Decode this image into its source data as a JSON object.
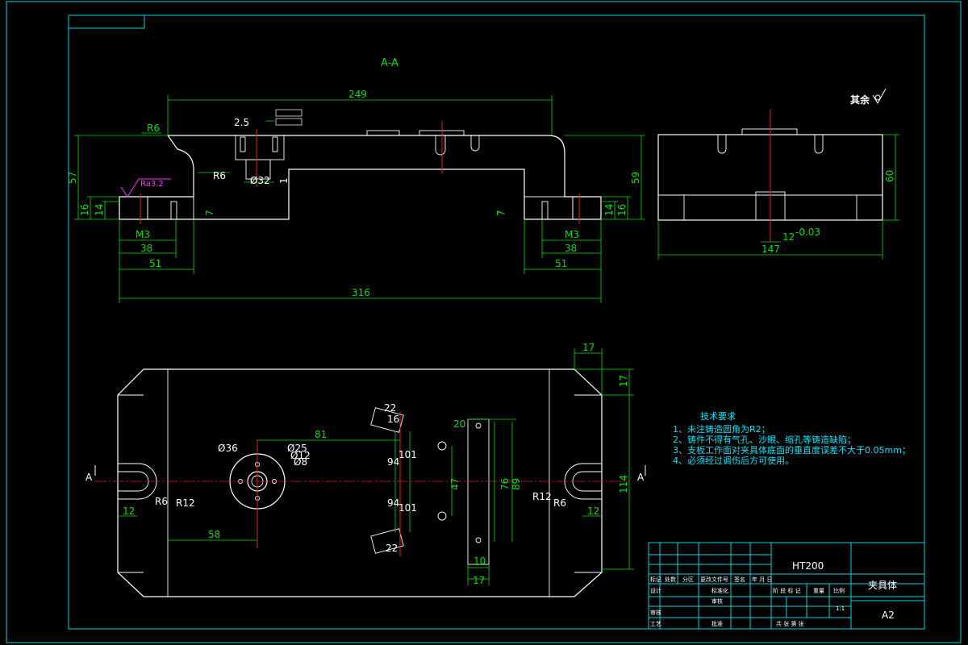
{
  "section_label": "A-A",
  "roughness_note": "其余",
  "ra_label": "Ra3.2",
  "section_marker": "A",
  "dims_top": {
    "d249": "249",
    "d316": "316",
    "d38L": "38",
    "d51L": "51",
    "d38R": "38",
    "d51R": "51",
    "d57": "57",
    "d59": "59",
    "d16L": "16",
    "d14L": "14",
    "d16R": "16",
    "d14R": "14",
    "d7L": "7",
    "d7R": "7",
    "m3L": "M3",
    "m3R": "M3",
    "r6a": "R6",
    "r6b": "R6",
    "d25": "2.5",
    "d32": "Ø32",
    "d1": "1",
    "d147": "147",
    "d60": "60",
    "d12": "12",
    "tol": "-0.03"
  },
  "dims_plan": {
    "d17a": "17",
    "d17b": "17",
    "d114": "114",
    "d81": "81",
    "d36": "Ø36",
    "d25": "Ø25",
    "d12b": "Ø12",
    "d8": "Ø8",
    "d58": "58",
    "r6L": "R6",
    "r12L": "R12",
    "r12R": "R12",
    "r6R": "R6",
    "d12L": "12",
    "d12R": "12",
    "d22a": "22",
    "d16a": "16",
    "d22b": "22",
    "d94a": "94",
    "d101a": "101",
    "d94b": "94",
    "d101b": "101",
    "d47": "47",
    "d76": "76",
    "d89": "89",
    "d20": "20",
    "d10": "10",
    "d17c": "17"
  },
  "tech": {
    "title": "技术要求",
    "items": [
      "1、未注铸造圆角为R2；",
      "2、铸件不得有气孔、沙眼、缩孔等铸造缺陷；",
      "3、支板工作面对夹具体底面的垂直度误差不大于0.05mm；",
      "4、必须经过调伤后方可使用。"
    ]
  },
  "title_block": {
    "material": "HT200",
    "name": "夹具体",
    "sheet": "A2",
    "scale": "1:1",
    "row_labels": [
      "标记",
      "处数",
      "分区",
      "更改文件号",
      "签名",
      "年 月 日"
    ],
    "design": "设计",
    "standard": "标准化",
    "stage_cols": [
      "阶 段 标 记",
      "重量",
      "比例"
    ],
    "review": "审核",
    "process": "工艺",
    "approve": "批准",
    "audit": "审核",
    "total": "共   张   第   张"
  }
}
